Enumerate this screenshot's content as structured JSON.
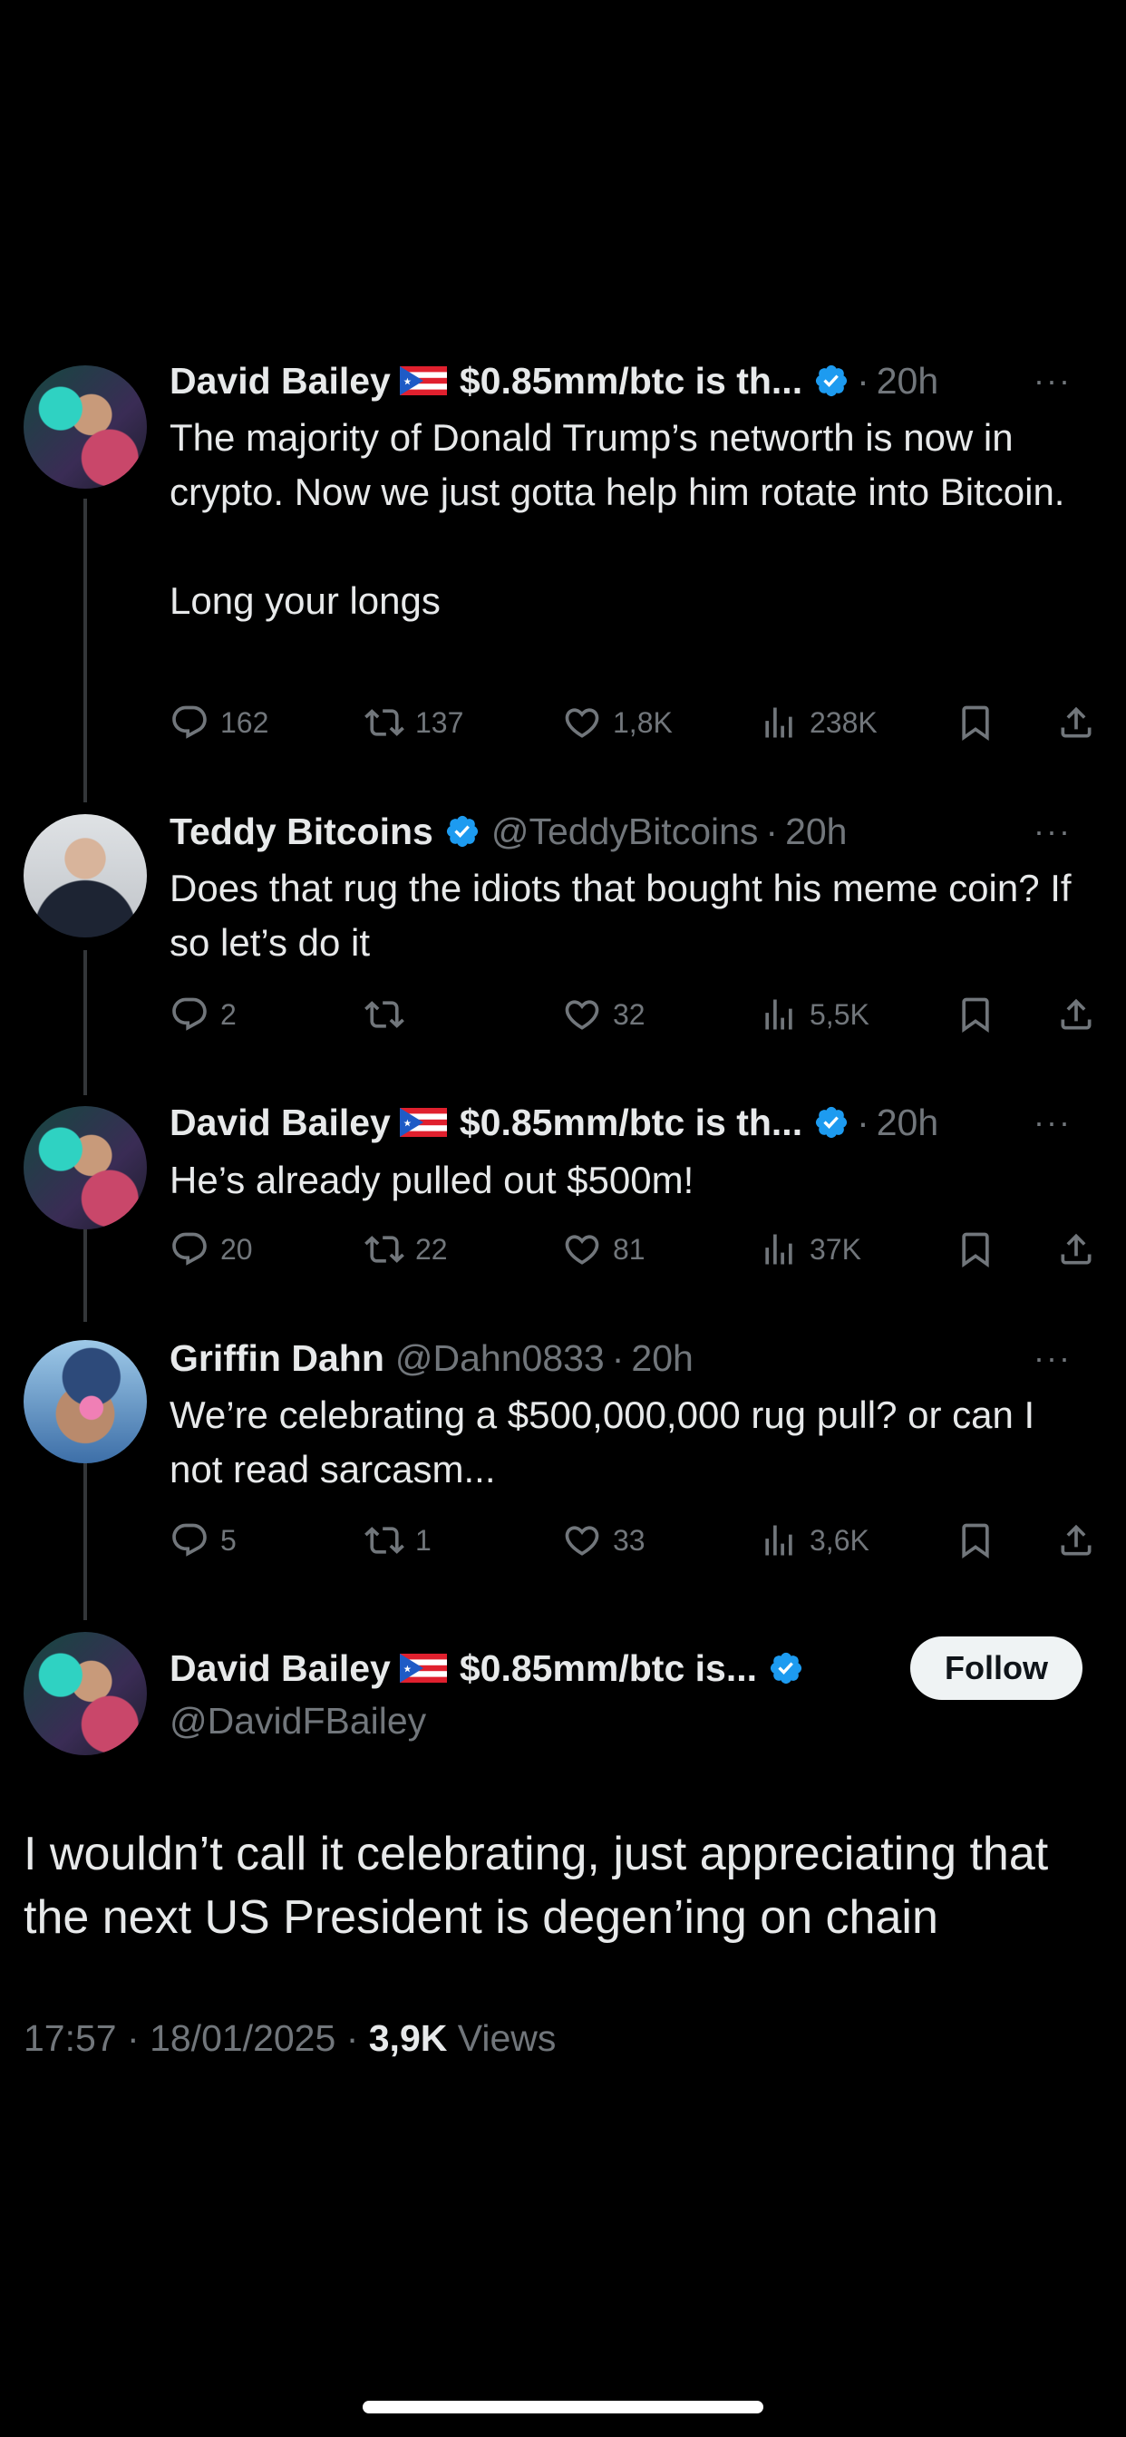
{
  "tweets": [
    {
      "name": "David Bailey",
      "display_suffix": "$0.85mm/btc is th...",
      "time": "20h",
      "text": "The majority of Donald Trump’s networth is now in crypto. Now we just gotta help him rotate into Bitcoin.\n\nLong your longs",
      "replies": "162",
      "retweets": "137",
      "likes": "1,8K",
      "views": "238K"
    },
    {
      "name": "Teddy Bitcoins",
      "handle": "@TeddyBitcoins",
      "time": "20h",
      "text": "Does that rug the idiots that bought his meme coin? If so let’s do it",
      "replies": "2",
      "retweets": "",
      "likes": "32",
      "views": "5,5K"
    },
    {
      "name": "David Bailey",
      "display_suffix": "$0.85mm/btc is th...",
      "time": "20h",
      "text": "He’s already pulled out $500m!",
      "replies": "20",
      "retweets": "22",
      "likes": "81",
      "views": "37K"
    },
    {
      "name": "Griffin Dahn",
      "handle": "@Dahn0833",
      "time": "20h",
      "text": "We’re celebrating a $500,000,000 rug pull? or can I not read sarcasm...",
      "replies": "5",
      "retweets": "1",
      "likes": "33",
      "views": "3,6K"
    }
  ],
  "main": {
    "name": "David Bailey",
    "display_suffix": "$0.85mm/btc is...",
    "handle": "@DavidFBailey",
    "follow_label": "Follow",
    "text": "I wouldn’t call it celebrating, just appreciating that the next US President is degen’ing on chain",
    "time": "17:57",
    "date": "18/01/2025",
    "views_count": "3,9K",
    "views_label": "Views"
  },
  "separator": "·",
  "more_glyph": "···",
  "colors": {
    "background": "#000000",
    "text": "#e7e9ea",
    "muted": "#71767b",
    "verified": "#1d9bf0"
  }
}
